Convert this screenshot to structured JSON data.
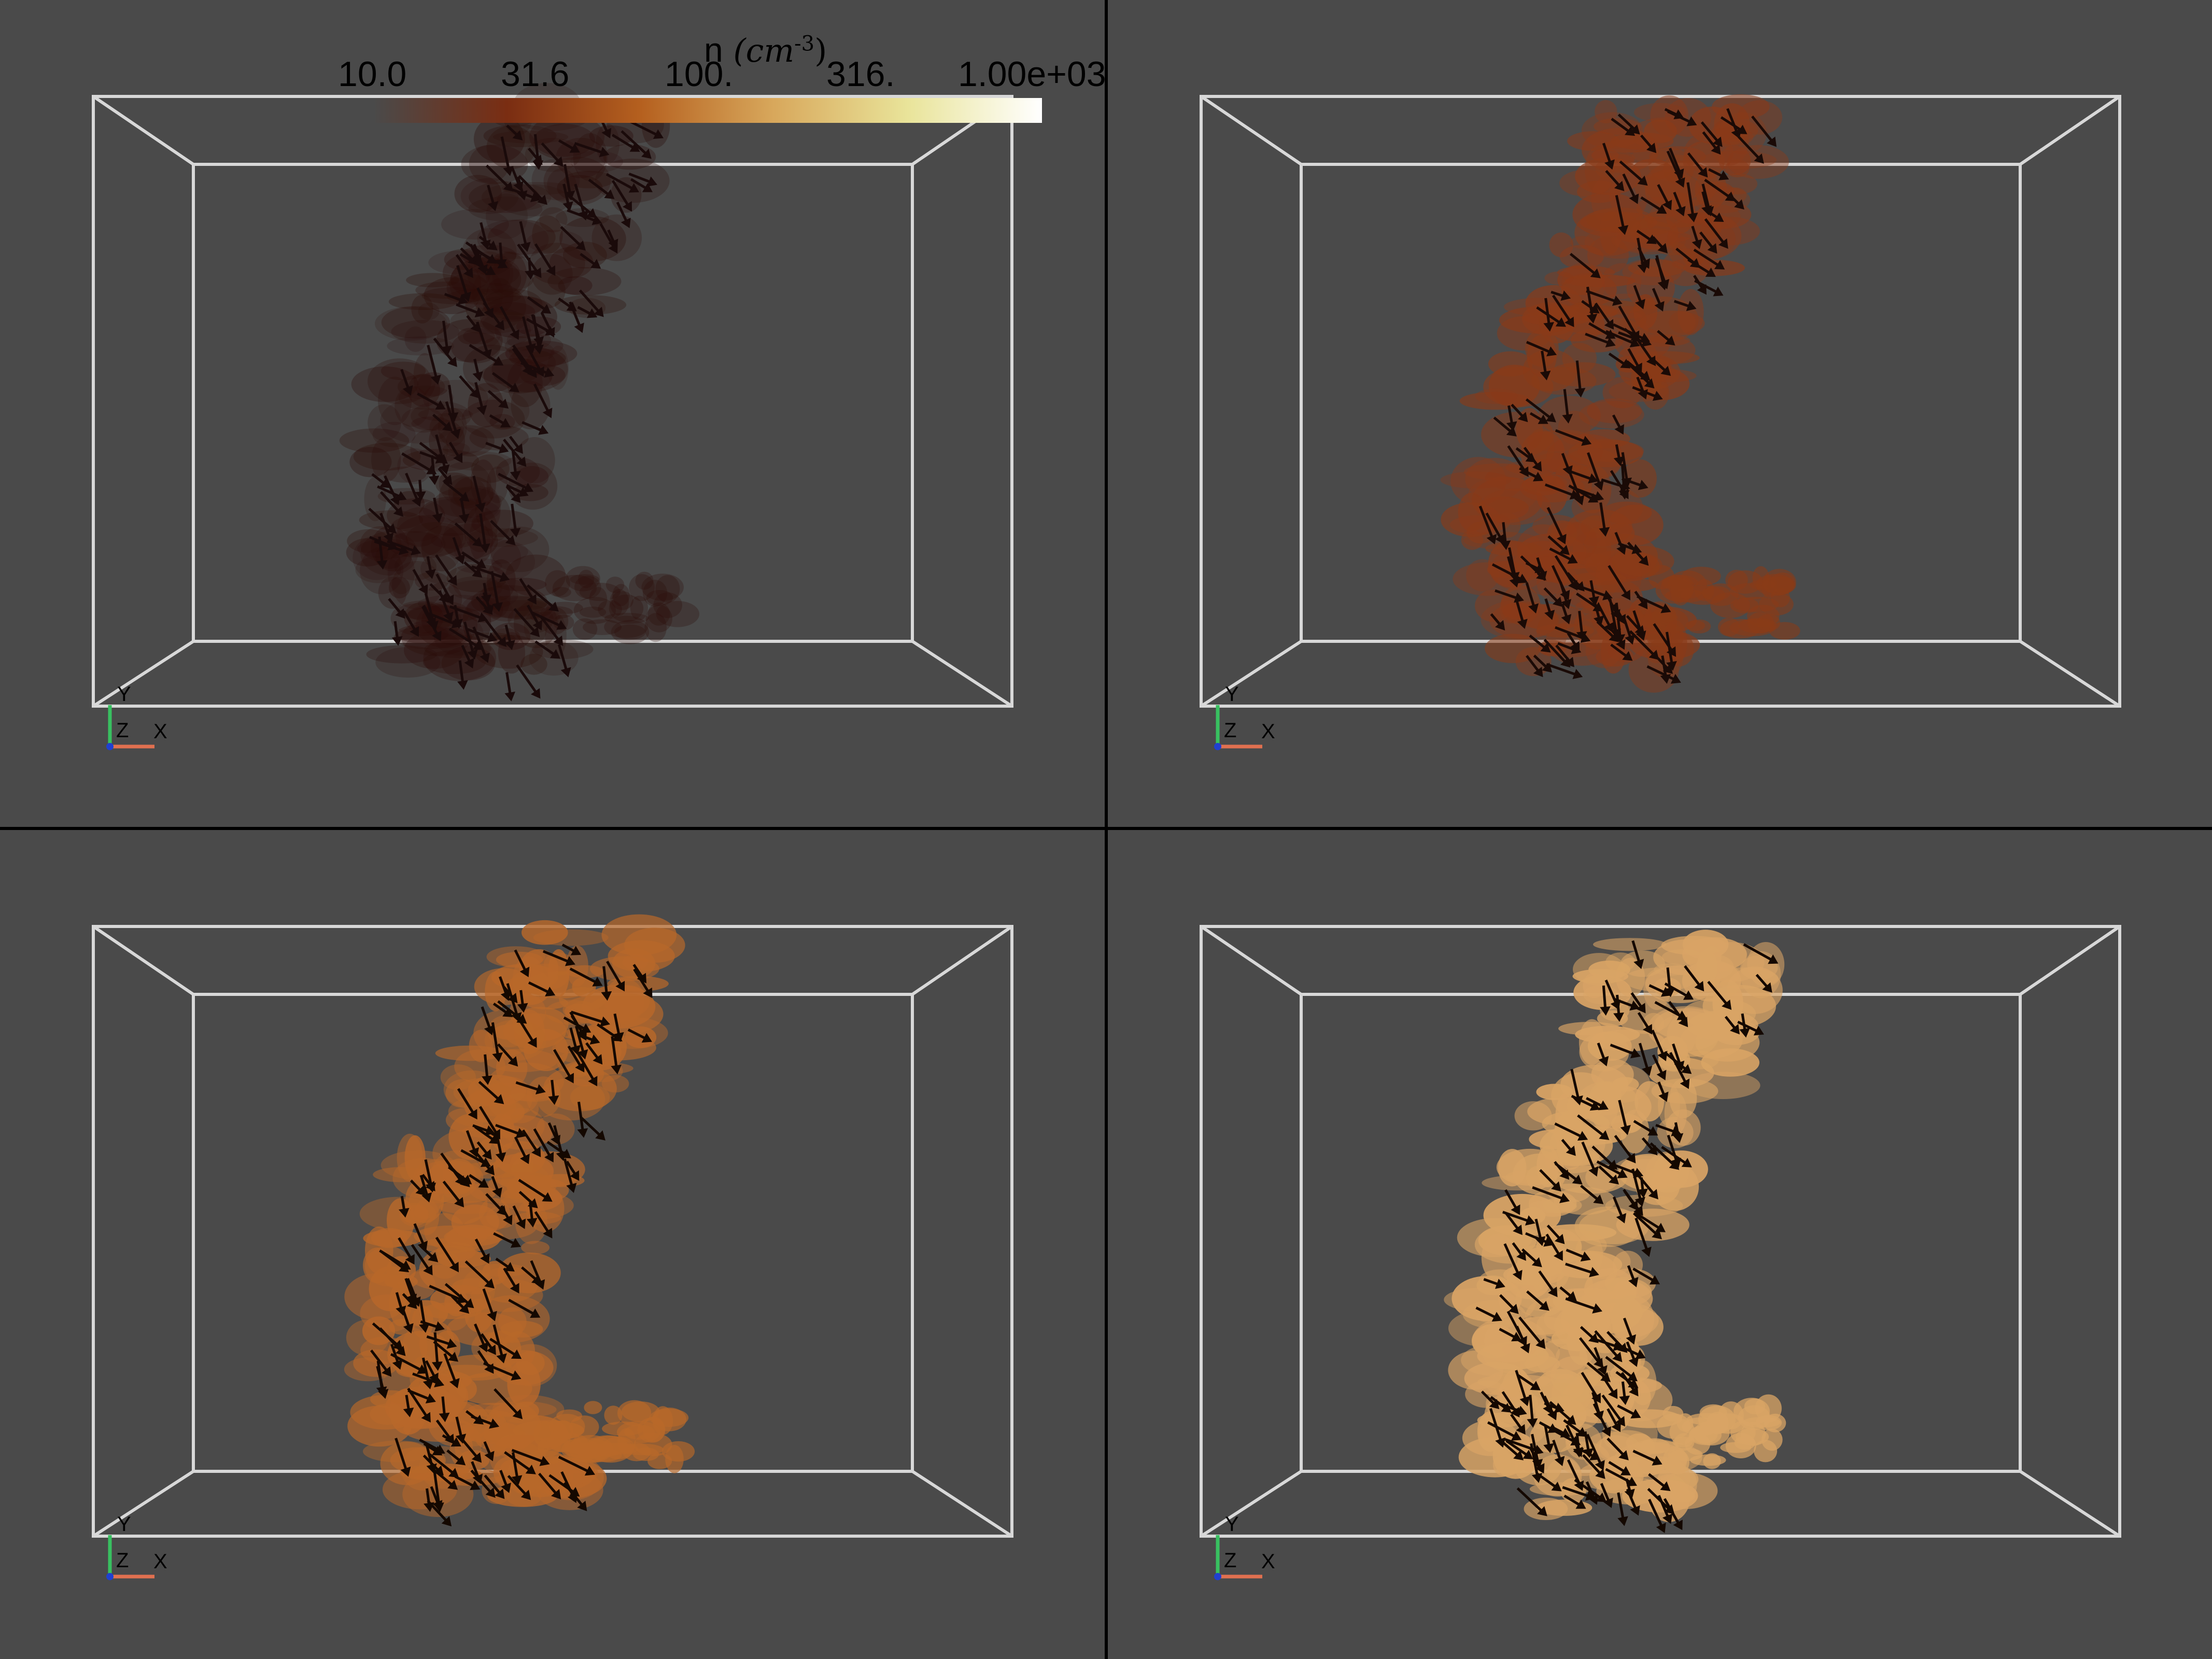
{
  "colorbar": {
    "title_var": "n",
    "title_unit": "(cm",
    "title_exp": "-3",
    "title_close": ")",
    "ticks": [
      "10.0",
      "31.6",
      "100.",
      "316.",
      "1.00e+03"
    ],
    "colors": [
      "#4a4a4a",
      "#7a2d12",
      "#b5601f",
      "#d8a85c",
      "#e9e49a",
      "#ffffff"
    ]
  },
  "axes_triad": {
    "x": "X",
    "y": "Y",
    "z": "Z",
    "x_color": "#e07050",
    "y_color": "#38c060",
    "z_color": "#2040d0"
  },
  "panels": [
    {
      "name": "top-left",
      "fill": "#2a0c08",
      "arrow": "#1a0a0a"
    },
    {
      "name": "top-right",
      "fill": "#8a3a18",
      "arrow": "#1a0a06"
    },
    {
      "name": "bottom-left",
      "fill": "#b8682a",
      "arrow": "#140800"
    },
    {
      "name": "bottom-right",
      "fill": "#d9a465",
      "arrow": "#140800"
    }
  ]
}
